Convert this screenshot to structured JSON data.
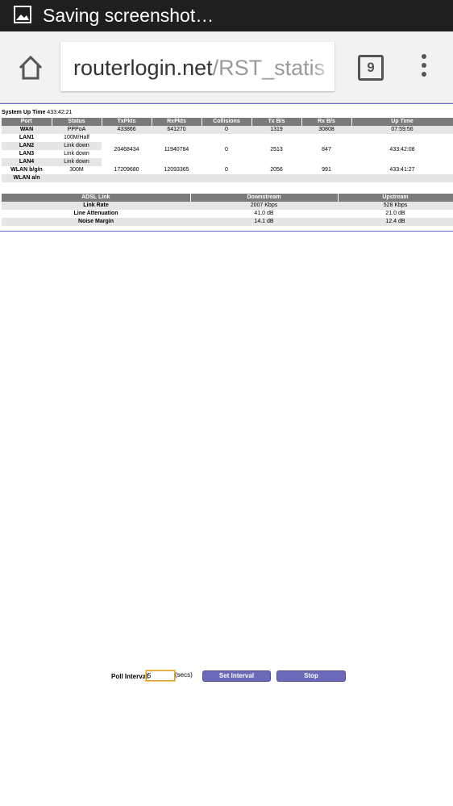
{
  "status_bar": {
    "text": "Saving screenshot…",
    "icon": "image-icon"
  },
  "browser": {
    "url_host": "routerlogin.net",
    "url_path": "/RST_statis",
    "tab_count": "9"
  },
  "page": {
    "uptime_label": "System Up Time",
    "uptime_value": "433:42:21",
    "stats": {
      "headers": [
        "Port",
        "Status",
        "TxPkts",
        "RxPkts",
        "Collisions",
        "Tx B/s",
        "Rx B/s",
        "Up Time"
      ],
      "wan": {
        "port": "WAN",
        "status": "PPPoA",
        "txpkts": "433866",
        "rxpkts": "641270",
        "collisions": "0",
        "txbs": "1319",
        "rxbs": "30808",
        "uptime": "07:59:56"
      },
      "lan_ports": [
        "LAN1",
        "LAN2",
        "LAN3",
        "LAN4"
      ],
      "lan_status": [
        "100M/Half",
        "Link down",
        "Link down",
        "Link down"
      ],
      "lan": {
        "txpkts": "20468434",
        "rxpkts": "11940784",
        "collisions": "0",
        "txbs": "2513",
        "rxbs": "847",
        "uptime": "433:42:08"
      },
      "wlan_bgn": {
        "port": "WLAN b/g/n",
        "status": "300M",
        "txpkts": "17209680",
        "rxpkts": "12093365",
        "collisions": "0",
        "txbs": "2056",
        "rxbs": "991",
        "uptime": "433:41:27"
      },
      "wlan_an": {
        "port": "WLAN a/n"
      }
    },
    "adsl": {
      "headers": [
        "ADSL Link",
        "Downstream",
        "Upstream"
      ],
      "rows": [
        {
          "label": "Link Rate",
          "down": "2007 Kbps",
          "up": "528 Kbps"
        },
        {
          "label": "Line Attenuation",
          "down": "41.0 dB",
          "up": "21.0 dB"
        },
        {
          "label": "Noise Margin",
          "down": "14.1 dB",
          "up": "12.4 dB"
        }
      ]
    },
    "poll": {
      "label": "Poll Interval",
      "colon": ":",
      "value": "5",
      "unit": "(secs)",
      "set_button": "Set Interval",
      "stop_button": "Stop"
    }
  }
}
